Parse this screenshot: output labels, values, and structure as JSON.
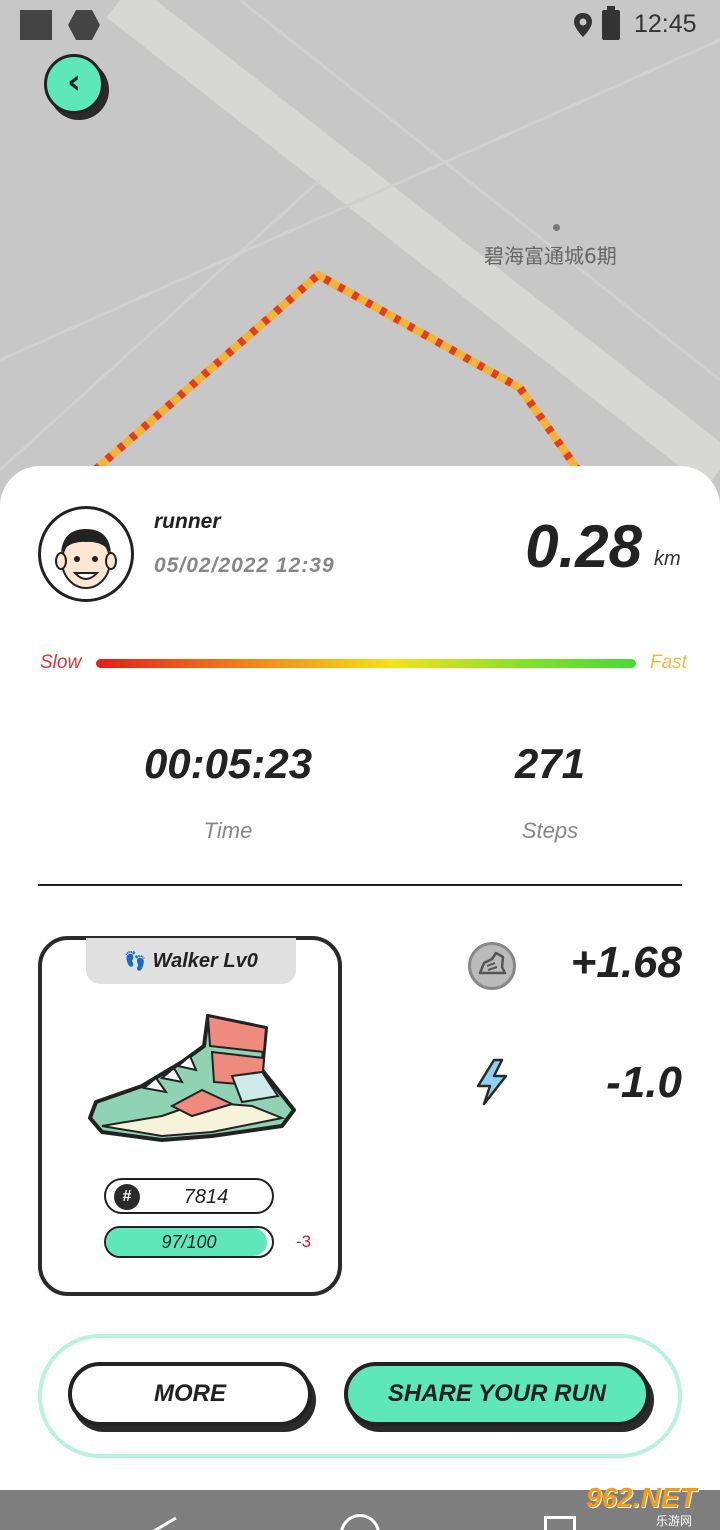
{
  "status_bar": {
    "time": "12:45"
  },
  "map": {
    "place_label": "碧海富通城6期"
  },
  "header": {
    "back_icon": "chevron-left-icon"
  },
  "user": {
    "name": "runner",
    "datetime": "05/02/2022 12:39"
  },
  "run": {
    "distance": "0.28",
    "distance_unit": "km",
    "speed_scale": {
      "slow": "Slow",
      "fast": "Fast"
    },
    "time": "00:05:23",
    "time_label": "Time",
    "steps": "271",
    "steps_label": "Steps"
  },
  "sneaker": {
    "type": "Walker Lv0",
    "hash_symbol": "#",
    "id": "7814",
    "durability_text": "97/100",
    "durability_fraction": 0.97,
    "durability_delta": "-3"
  },
  "earnings": {
    "reward_icon": "sneaker-token-icon",
    "reward": "+1.68",
    "energy_icon": "lightning-icon",
    "energy": "-1.0"
  },
  "actions": {
    "more_label": "MORE",
    "share_label": "SHARE YOUR RUN"
  },
  "watermark": {
    "big": "962.NET",
    "small": "乐游网"
  },
  "colors": {
    "accent": "#5ee8b9",
    "slow": "#e21d1d",
    "fast": "#e9bf45",
    "delta": "#c23333"
  }
}
